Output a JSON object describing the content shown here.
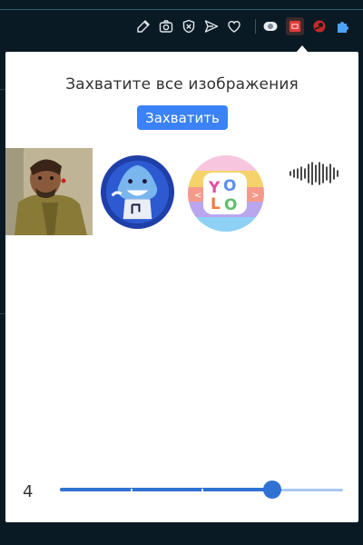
{
  "toolbar": {
    "icons": [
      "edit-icon",
      "camera-icon",
      "shield-x-icon",
      "send-icon",
      "heart-icon",
      "toggle-icon",
      "image-capture-extension-icon",
      "red-extension-icon"
    ]
  },
  "popup": {
    "title": "Захватите все изображения",
    "capture_label": "Захватить",
    "images": [
      "portrait-photo",
      "shark-sticker",
      "yolo-sticker",
      "audio-wave-graphic"
    ],
    "slider": {
      "label": "4",
      "fraction": 0.75,
      "ticks": 4
    }
  },
  "colors": {
    "accent": "#3b82f6",
    "slider": "#2f72d4",
    "page_bg": "#0a1a24"
  }
}
